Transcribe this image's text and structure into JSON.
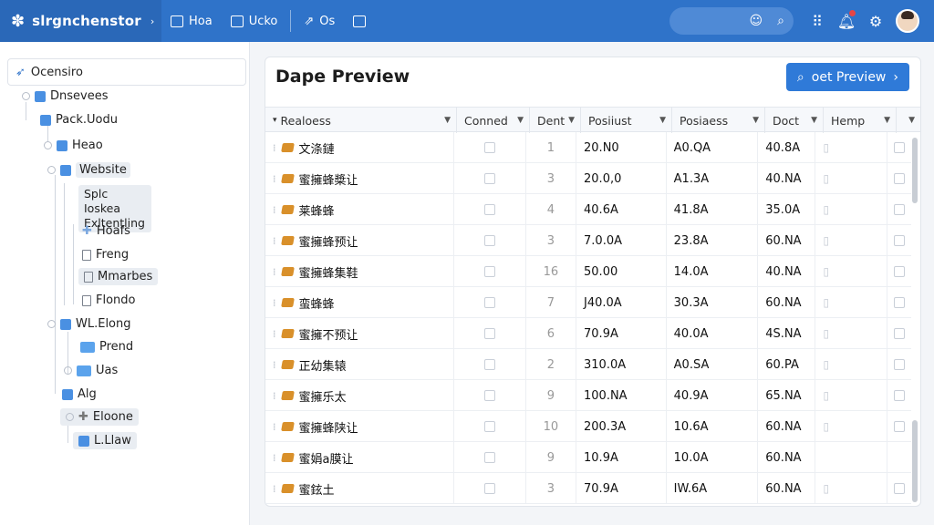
{
  "app": {
    "title": "slrgnchenstor"
  },
  "nav": [
    {
      "label": "Hoa",
      "icon": "table-icon"
    },
    {
      "label": "Ucko",
      "icon": "window-icon"
    },
    {
      "label": "Os",
      "icon": "share-icon"
    },
    {
      "label": "",
      "icon": "export-icon"
    }
  ],
  "topbar_icons": [
    "user-search-icon",
    "search-icon",
    "grid-icon",
    "bell-icon",
    "gear-icon"
  ],
  "sidebar": {
    "header": "Ocensiro",
    "tree": [
      {
        "label": "Dnsevees"
      },
      {
        "label": "Pack.Uodu"
      },
      {
        "label": "Heao"
      },
      {
        "label": "Website"
      },
      {
        "label": "Splc Ioskea Exltentling"
      },
      {
        "label": "Hoafs"
      },
      {
        "label": "Freng"
      },
      {
        "label": "Mmarbes"
      },
      {
        "label": "Flondo"
      },
      {
        "label": "WL.Elong"
      },
      {
        "label": "Prend"
      },
      {
        "label": "Uas"
      },
      {
        "label": "Alg"
      },
      {
        "label": "Eloone"
      },
      {
        "label": "L.Llaw"
      }
    ]
  },
  "panel": {
    "title": "Dape Preview",
    "button_label": "oet Preview"
  },
  "table": {
    "columns": [
      "Realoess",
      "Conned",
      "Dent",
      "Posiiust",
      "Posiaess",
      "Doct",
      "Hemp",
      ""
    ],
    "rows": [
      {
        "name": "文涤鏈",
        "conned": "",
        "dent": "1",
        "p1": "20.N0",
        "p2": "A0.QA",
        "doct": "40.8A"
      },
      {
        "name": "蜜擁蜂槳让",
        "conned": "",
        "dent": "3",
        "p1": "20.0,0",
        "p2": "A1.3A",
        "doct": "40.NA"
      },
      {
        "name": "莱蜂蜂",
        "conned": "",
        "dent": "4",
        "p1": "40.6A",
        "p2": "41.8A",
        "doct": "35.0A"
      },
      {
        "name": "蜜擁蜂预让",
        "conned": "",
        "dent": "3",
        "p1": "7.0.0A",
        "p2": "23.8A",
        "doct": "60.NA"
      },
      {
        "name": "蜜擁蜂集鞋",
        "conned": "",
        "dent": "16",
        "p1": "50.00",
        "p2": "14.0A",
        "doct": "40.NA"
      },
      {
        "name": "蛮蜂蜂",
        "conned": "",
        "dent": "7",
        "p1": "J40.0A",
        "p2": "30.3A",
        "doct": "60.NA"
      },
      {
        "name": "蜜擁不预让",
        "conned": "",
        "dent": "6",
        "p1": "70.9A",
        "p2": "40.0A",
        "doct": "4S.NA"
      },
      {
        "name": "正幼集辕",
        "conned": "",
        "dent": "2",
        "p1": "310.0A",
        "p2": "A0.SA",
        "doct": "60.PA"
      },
      {
        "name": "蜜擁乐太",
        "conned": "",
        "dent": "9",
        "p1": "100.NA",
        "p2": "40.9A",
        "doct": "65.NA"
      },
      {
        "name": "蜜擁蜂陕让",
        "conned": "",
        "dent": "10",
        "p1": "200.3A",
        "p2": "10.6A",
        "doct": "60.NA"
      },
      {
        "name": "蜜娟a膜让",
        "conned": "",
        "dent": "9",
        "p1": "10.9A",
        "p2": "10.0A",
        "doct": "60.NA"
      },
      {
        "name": "蜜鉉土",
        "conned": "",
        "dent": "3",
        "p1": "70.9A",
        "p2": "IW.6A",
        "doct": "60.NA"
      }
    ]
  }
}
